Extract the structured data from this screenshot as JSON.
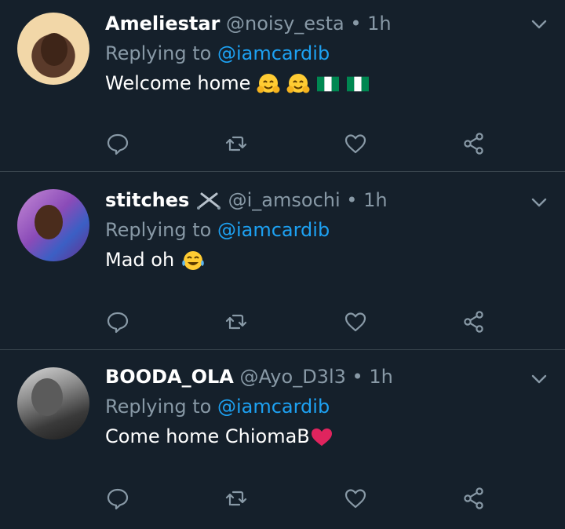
{
  "tweets": [
    {
      "name": "Ameliestar",
      "handle": "@noisy_esta",
      "dot": "•",
      "time": "1h",
      "replying_prefix": "Replying to",
      "replying_to": "@iamcardib",
      "text": "Welcome home",
      "emojis": [
        "hugging-face",
        "hugging-face",
        "nigeria-flag",
        "nigeria-flag"
      ]
    },
    {
      "name": "stitches",
      "name_emoji": "crossed-swords",
      "handle": "@i_amsochi",
      "dot": "•",
      "time": "1h",
      "replying_prefix": "Replying to",
      "replying_to": "@iamcardib",
      "text": "Mad oh",
      "emojis": [
        "tears-of-joy"
      ]
    },
    {
      "name": "BOODA_OLA",
      "handle": "@Ayo_D3l3",
      "dot": "•",
      "time": "1h",
      "replying_prefix": "Replying to",
      "replying_to": "@iamcardib",
      "text": "Come home ChiomaB",
      "emojis": [
        "red-heart"
      ]
    }
  ],
  "colors": {
    "background": "#15202b",
    "divider": "#38444d",
    "muted": "#8899a6",
    "accent": "#1da1f2"
  }
}
